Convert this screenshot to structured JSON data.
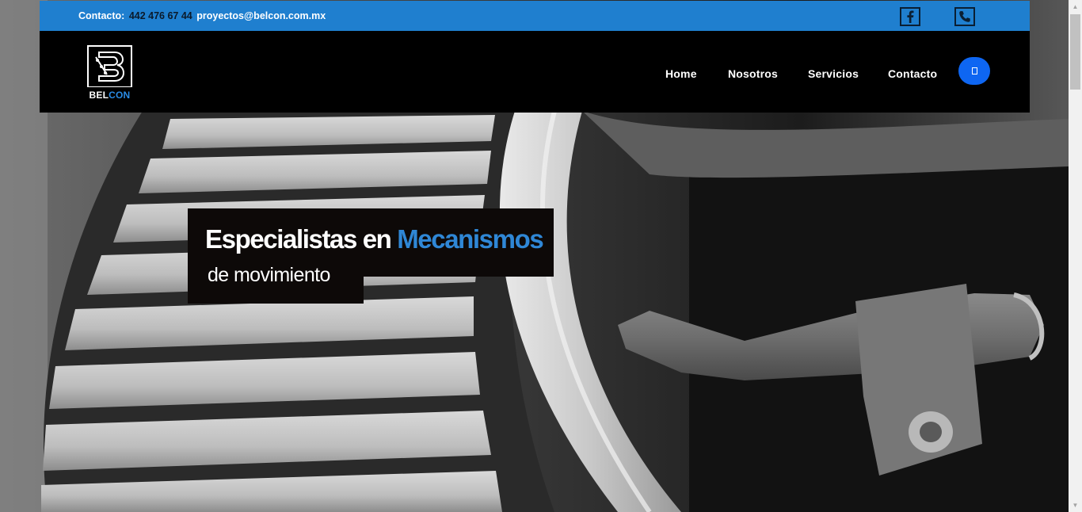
{
  "topbar": {
    "contact_label": "Contacto:",
    "phone": "442 476 67 44",
    "email": "proyectos@belcon.com.mx",
    "social": [
      {
        "name": "facebook-icon",
        "glyph": "f"
      },
      {
        "name": "phone-icon",
        "glyph": "phone"
      }
    ]
  },
  "header": {
    "logo": {
      "word_main": "BEL",
      "word_accent": "CON"
    },
    "nav": [
      "Home",
      "Nosotros",
      "Servicios",
      "Contacto"
    ],
    "menu_button_icon": "menu-icon"
  },
  "hero": {
    "headline_main": "Especialistas en",
    "headline_accent": "Mecanismos",
    "subline": "de movimiento"
  },
  "colors": {
    "topbar": "#1f7fcf",
    "header": "#000000",
    "accent_blue": "#2f87d6",
    "menu_button": "#0e66f2",
    "headline_box": "#0d0908"
  }
}
